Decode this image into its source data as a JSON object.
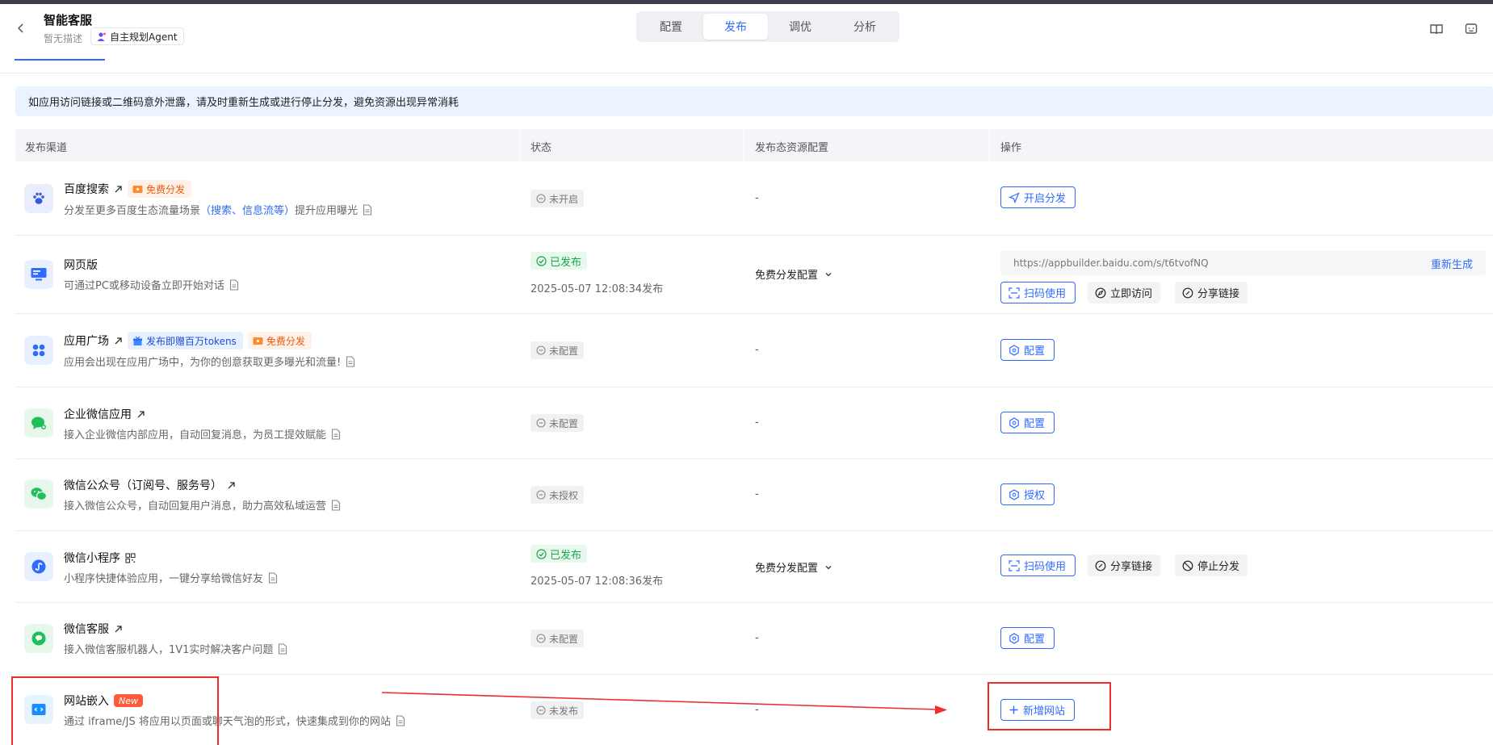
{
  "header": {
    "app_title": "智能客服",
    "app_desc": "暂无描述",
    "agent_tag": "自主规划Agent",
    "tabs": [
      {
        "label": "配置",
        "active": false
      },
      {
        "label": "发布",
        "active": true
      },
      {
        "label": "调优",
        "active": false
      },
      {
        "label": "分析",
        "active": false
      }
    ],
    "icons": [
      "book-icon",
      "chat-icon"
    ]
  },
  "notice": "如应用访问链接或二维码意外泄露，请及时重新生成或进行停止分发，避免资源出现异常消耗",
  "table": {
    "columns": [
      "发布渠道",
      "状态",
      "发布态资源配置",
      "操作"
    ],
    "rows": [
      {
        "name": "百度搜索",
        "badges": [
          "免费分发"
        ],
        "desc_before": "分发至更多百度生态流量场景",
        "desc_highlight": "（搜索、信息流等）",
        "desc_after": "提升应用曝光",
        "status": "未开启",
        "resource": "-",
        "actions": [
          "开启分发"
        ]
      },
      {
        "name": "网页版",
        "desc": "可通过PC或移动设备立即开始对话",
        "status": "已发布",
        "publish_time": "2025-05-07 12:08:34发布",
        "resource": "免费分发配置",
        "url": "https://appbuilder.baidu.com/s/t6tvofNQ",
        "regen": "重新生成",
        "actions": [
          "扫码使用",
          "立即访问",
          "分享链接"
        ]
      },
      {
        "name": "应用广场",
        "badges": [
          "发布即赠百万tokens",
          "免费分发"
        ],
        "desc": "应用会出现在应用广场中，为你的创意获取更多曝光和流量!",
        "status": "未配置",
        "resource": "-",
        "actions": [
          "配置"
        ]
      },
      {
        "name": "企业微信应用",
        "desc": "接入企业微信内部应用，自动回复消息，为员工提效赋能",
        "status": "未配置",
        "resource": "-",
        "actions": [
          "配置"
        ]
      },
      {
        "name": "微信公众号（订阅号、服务号）",
        "desc": "接入微信公众号，自动回复用户消息，助力高效私域运营",
        "status": "未授权",
        "resource": "-",
        "actions": [
          "授权"
        ]
      },
      {
        "name": "微信小程序",
        "desc": "小程序快捷体验应用，一键分享给微信好友",
        "status": "已发布",
        "publish_time": "2025-05-07 12:08:36发布",
        "resource": "免费分发配置",
        "actions": [
          "扫码使用",
          "分享链接",
          "停止分发"
        ]
      },
      {
        "name": "微信客服",
        "desc": "接入微信客服机器人，1V1实时解决客户问题",
        "status": "未配置",
        "resource": "-",
        "actions": [
          "配置"
        ]
      },
      {
        "name": "网站嵌入",
        "new_badge": "New",
        "desc": "通过 iframe/JS 将应用以页面或聊天气泡的形式，快速集成到你的网站",
        "status": "未发布",
        "resource": "-",
        "actions": [
          "新增网站"
        ]
      }
    ]
  },
  "colors": {
    "accent": "#2f6bff",
    "annotation_red": "#ef2d2d",
    "published_green": "#1aa64a",
    "free_orange": "#e8590c"
  }
}
